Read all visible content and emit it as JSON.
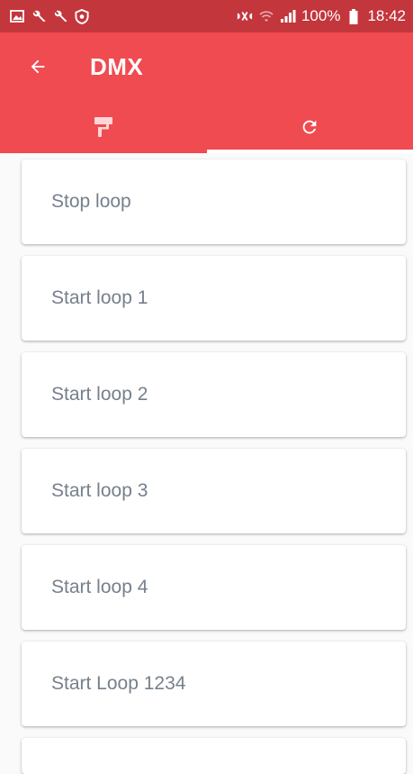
{
  "status_bar": {
    "left_icons": [
      "gallery-icon",
      "wrench-icon",
      "wrench-icon",
      "shield-icon"
    ],
    "right_icons": [
      "mute-icon",
      "wifi-icon",
      "signal-icon"
    ],
    "battery": "100%",
    "time": "18:42"
  },
  "app_bar": {
    "title": "DMX",
    "colors": {
      "status_bar": "#c3363c",
      "app_bar": "#ef4b51"
    }
  },
  "tabs": [
    {
      "icon": "paint-roller-icon",
      "active": false
    },
    {
      "icon": "refresh-icon",
      "active": true
    }
  ],
  "items": [
    {
      "label": "Stop loop"
    },
    {
      "label": "Start loop 1"
    },
    {
      "label": "Start loop 2"
    },
    {
      "label": "Start loop 3"
    },
    {
      "label": "Start loop 4"
    },
    {
      "label": "Start Loop 1234"
    }
  ]
}
